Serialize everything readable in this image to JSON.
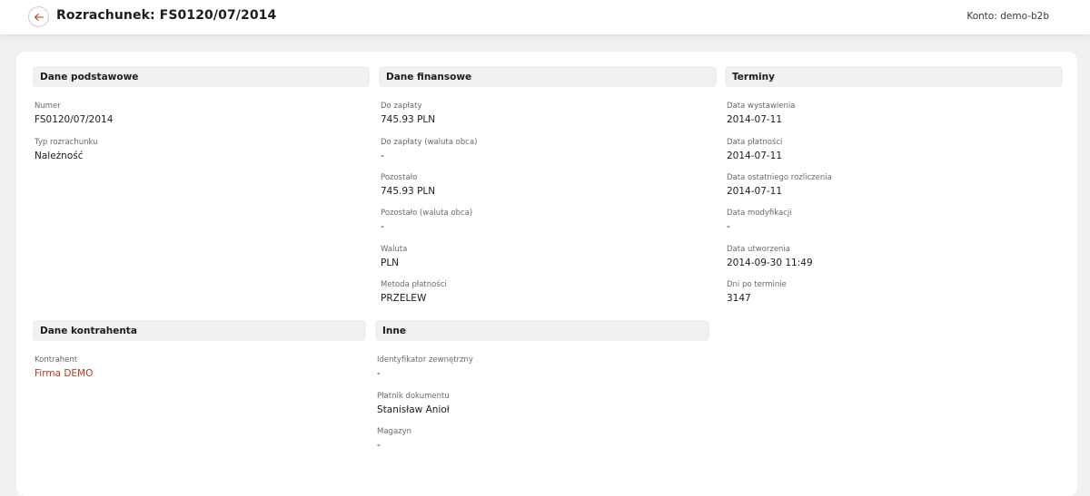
{
  "header": {
    "title": "Rozrachunek: FS0120/07/2014",
    "account": "Konto: demo-b2b"
  },
  "sections": {
    "basic": {
      "title": "Dane podstawowe",
      "fields": [
        {
          "label": "Numer",
          "value": "FS0120/07/2014"
        },
        {
          "label": "Typ rozrachunku",
          "value": "Należność"
        }
      ]
    },
    "finance": {
      "title": "Dane finansowe",
      "fields": [
        {
          "label": "Do zapłaty",
          "value": "745.93 PLN"
        },
        {
          "label": "Do zapłaty (waluta obca)",
          "value": "-"
        },
        {
          "label": "Pozostało",
          "value": "745.93 PLN"
        },
        {
          "label": "Pozostało (waluta obca)",
          "value": "-"
        },
        {
          "label": "Waluta",
          "value": "PLN"
        },
        {
          "label": "Metoda płatności",
          "value": "PRZELEW"
        }
      ]
    },
    "terms": {
      "title": "Terminy",
      "fields": [
        {
          "label": "Data wystawienia",
          "value": "2014-07-11"
        },
        {
          "label": "Data płatności",
          "value": "2014-07-11"
        },
        {
          "label": "Data ostatniego rozliczenia",
          "value": "2014-07-11"
        },
        {
          "label": "Data modyfikacji",
          "value": "-"
        },
        {
          "label": "Data utworzenia",
          "value": "2014-09-30 11:49"
        },
        {
          "label": "Dni po terminie",
          "value": "3147"
        }
      ]
    },
    "contractor": {
      "title": "Dane kontrahenta",
      "fields": [
        {
          "label": "Kontrahent",
          "value": "Firma DEMO"
        }
      ]
    },
    "other": {
      "title": "Inne",
      "fields": [
        {
          "label": "Identyfikator zewnętrzny",
          "value": "-"
        },
        {
          "label": "Płatnik dokumentu",
          "value": "Stanisław Anioł"
        },
        {
          "label": "Magazyn",
          "value": "-"
        }
      ]
    }
  },
  "colors": {
    "link": "#b03a22",
    "accent_border": "#e2c6c0"
  }
}
